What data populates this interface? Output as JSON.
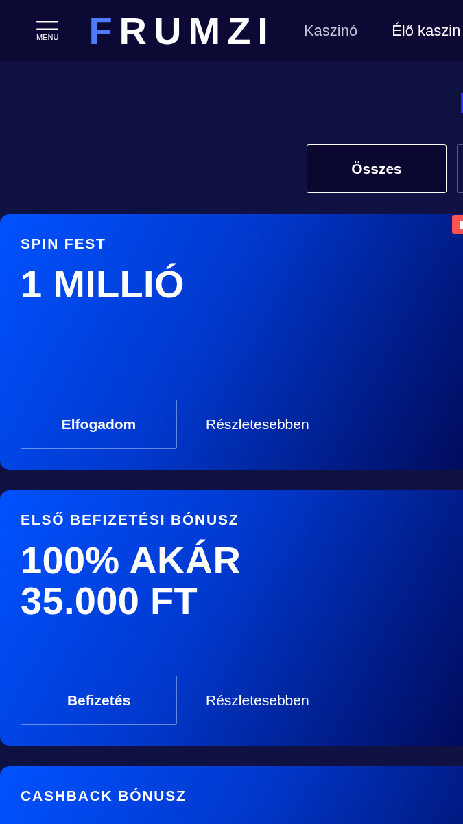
{
  "header": {
    "menu_button": {
      "label": "MENU"
    },
    "logo": {
      "accent_part": "F",
      "rest": "RUMZI"
    },
    "nav": [
      {
        "label": "Kaszinó",
        "selected": false
      },
      {
        "label": "Élő kaszin",
        "selected": true
      }
    ]
  },
  "filters": [
    {
      "label": "Összes",
      "selected": true
    },
    {
      "selected": false
    }
  ],
  "cards": [
    {
      "title": "SPIN FEST",
      "headline": "1 MILLIÓ",
      "corner_tag": true,
      "actions": [
        {
          "kind": "button",
          "label": "Elfogadom"
        },
        {
          "kind": "link",
          "label": "Részletesebben"
        }
      ]
    },
    {
      "title": "ELSŐ BEFIZETÉSI BÓNUSZ",
      "headline": "100% AKÁR 35.000 FT",
      "corner_tag": false,
      "actions": [
        {
          "kind": "button",
          "label": "Befizetés"
        },
        {
          "kind": "link",
          "label": "Részletesebben"
        }
      ]
    },
    {
      "title": "CASHBACK BÓNUSZ",
      "corner_tag": false
    }
  ]
}
